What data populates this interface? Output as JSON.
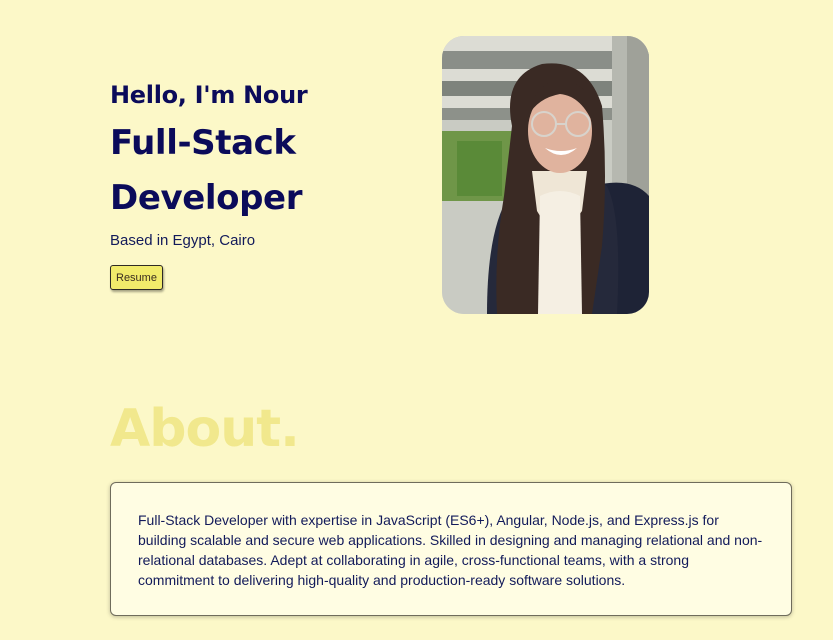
{
  "hero": {
    "greeting": "Hello, I'm Nour",
    "title_line1": "Full-Stack",
    "title_line2": "Developer",
    "location": "Based in Egypt, Cairo",
    "resume_label": "Resume"
  },
  "about": {
    "heading": "About.",
    "text": "Full-Stack Developer with expertise in JavaScript (ES6+), Angular, Node.js, and Express.js for building scalable and secure web applications. Skilled in designing and managing relational and non-relational databases. Adept at collaborating in agile, cross-functional teams, with a strong commitment to delivering high-quality and production-ready software solutions."
  },
  "colors": {
    "page_background": "#fcf8c8",
    "heading_navy": "#0b0b5a",
    "about_heading": "#f1e88d",
    "button_yellow": "#f1eb6b",
    "card_background": "#fffde3"
  }
}
